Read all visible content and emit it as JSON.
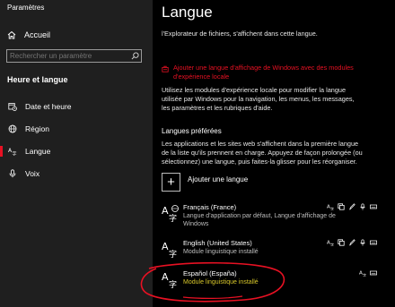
{
  "window": {
    "title": "Paramètres"
  },
  "sidebar": {
    "home_label": "Accueil",
    "search_placeholder": "Rechercher un paramètre",
    "section_title": "Heure et langue",
    "items": [
      {
        "label": "Date et heure",
        "icon": "calendar-clock-icon",
        "active": false
      },
      {
        "label": "Région",
        "icon": "globe-icon",
        "active": false
      },
      {
        "label": "Langue",
        "icon": "language-icon",
        "active": true
      },
      {
        "label": "Voix",
        "icon": "microphone-icon",
        "active": false
      }
    ]
  },
  "main": {
    "title": "Langue",
    "intro": "l'Explorateur de fichiers, s'affichent dans cette langue.",
    "add_display_lang_link": "Ajouter une langue d'affichage de Windows avec des modules d'expérience locale",
    "local_modules_text": "Utilisez les modules d'expérience locale pour modifier la langue utilisée par Windows pour la navigation, les menus, les messages, les paramètres et les rubriques d'aide.",
    "preferred_heading": "Langues préférées",
    "preferred_text": "Les applications et les sites web s'affichent dans la première langue de la liste qu'ils prennent en charge. Appuyez de façon prolongée (ou sélectionnez) une langue, puis faites-la glisser pour les réorganiser.",
    "add_language_label": "Ajouter une langue",
    "languages": [
      {
        "name": "Français (France)",
        "detail": "Langue d'application par défaut, Langue d'affichage de Windows",
        "features": [
          "language-options-icon",
          "text-to-speech-icon",
          "handwriting-icon",
          "speech-recognition-icon",
          "keyboard-icon"
        ]
      },
      {
        "name": "English (United States)",
        "detail": "Module linguistique installé",
        "features": [
          "language-options-icon",
          "text-to-speech-icon",
          "handwriting-icon",
          "speech-recognition-icon",
          "keyboard-icon"
        ]
      },
      {
        "name": "Español (España)",
        "detail": "Module linguistique installé",
        "features": [
          "language-options-icon",
          "keyboard-icon"
        ]
      }
    ]
  },
  "colors": {
    "accent": "#e81123",
    "highlight": "#d8c72a",
    "sidebar_bg": "#1f1f1f",
    "main_bg": "#000000"
  }
}
